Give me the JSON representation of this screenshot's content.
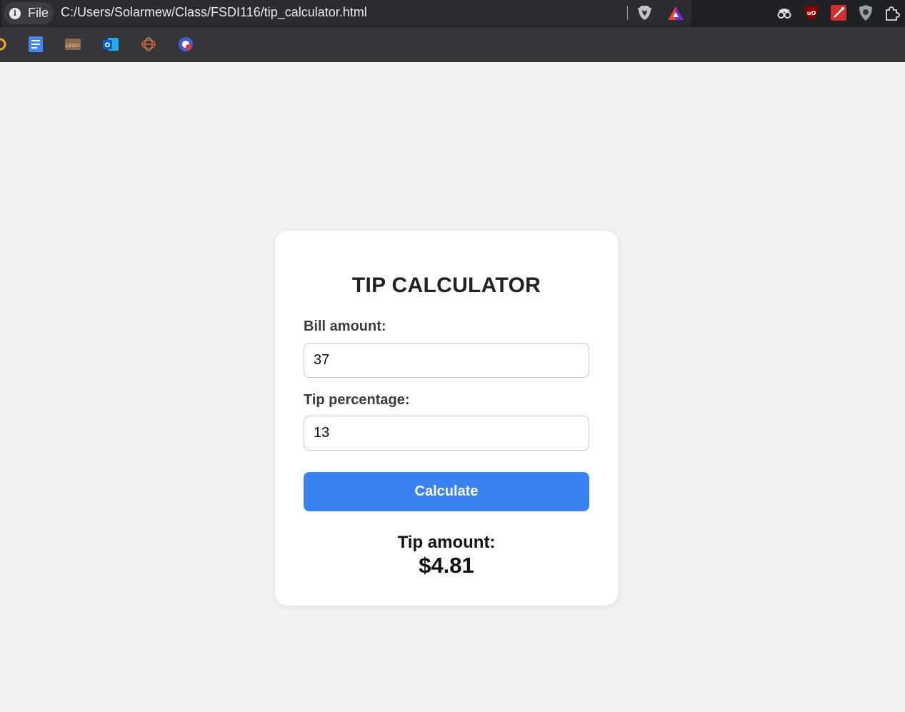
{
  "browser": {
    "site_chip_label": "File",
    "url": "C:/Users/Solarmew/Class/FSDI116/tip_calculator.html"
  },
  "calculator": {
    "title": "TIP CALCULATOR",
    "bill_label": "Bill amount:",
    "bill_value": "37",
    "tip_label": "Tip percentage:",
    "tip_value": "13",
    "button_label": "Calculate",
    "result_label": "Tip amount:",
    "result_value": "$4.81"
  },
  "colors": {
    "accent": "#3b82f1",
    "page_bg": "#f2f2f2",
    "chrome_bg": "#35363a"
  }
}
